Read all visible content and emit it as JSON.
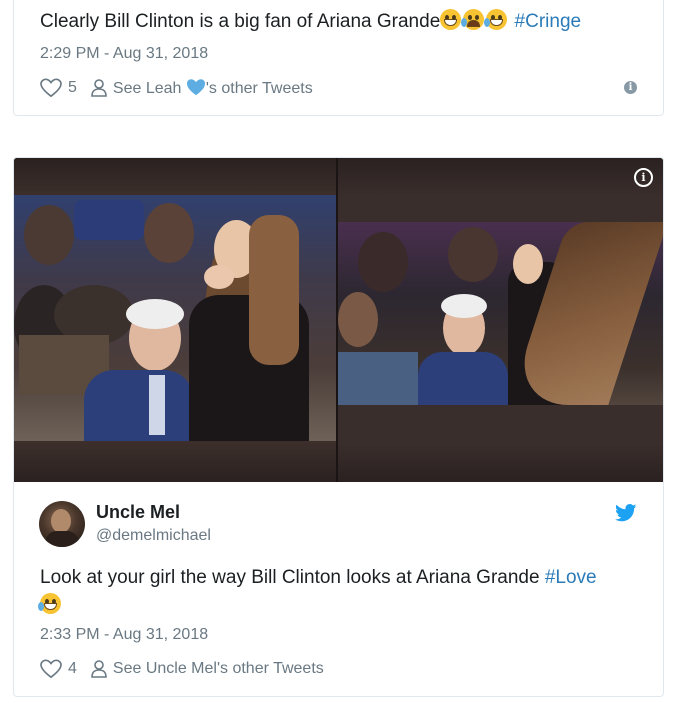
{
  "tweet1": {
    "text": "Clearly Bill Clinton is a big fan of Ariana Grande",
    "emojis": [
      "grimacing-face",
      "loudly-crying-face",
      "face-with-tears-of-joy"
    ],
    "hashtag": "#Cringe",
    "timestamp": "2:29 PM - Aug 31, 2018",
    "likes": "5",
    "see_other_prefix": "See Leah",
    "see_other_suffix": "'s other Tweets",
    "info_icon": "i"
  },
  "tweet2": {
    "media_info_icon": "i",
    "author": {
      "name": "Uncle Mel",
      "handle": "@demelmichael"
    },
    "text": "Look at your girl the way Bill Clinton looks at Ariana Grande",
    "hashtag": "#Love",
    "emoji": "face-with-tears-of-joy",
    "timestamp": "2:33 PM - Aug 31, 2018",
    "likes": "4",
    "see_other": "See Uncle Mel's other Tweets"
  },
  "colors": {
    "link": "#2b7bb9",
    "muted": "#697882",
    "twitter_blue": "#1da1f2",
    "border": "#e1e8ed"
  }
}
